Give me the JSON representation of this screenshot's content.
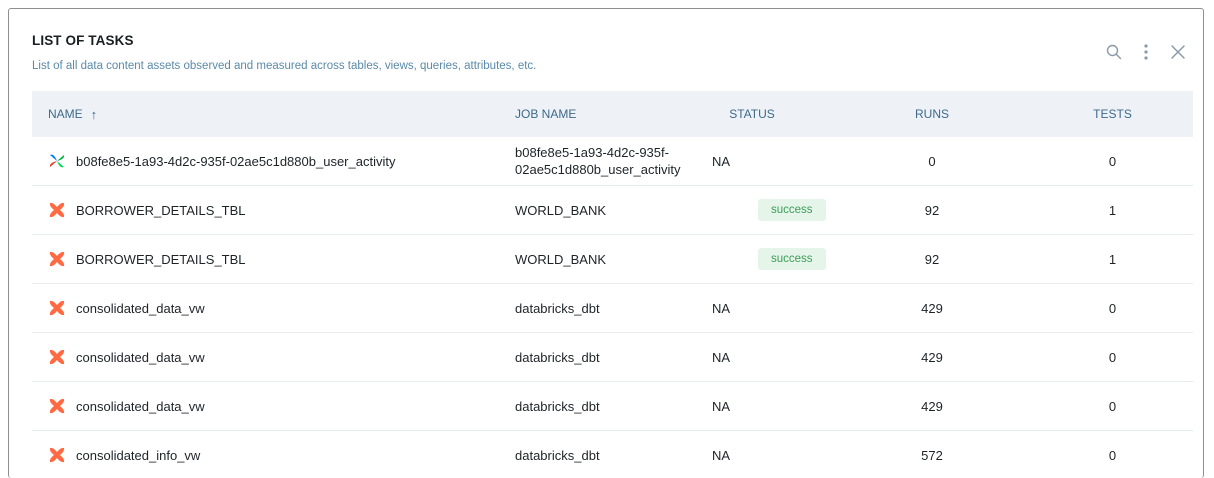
{
  "header": {
    "title": "LIST OF TASKS",
    "subtitle": "List of all data content assets observed and measured across tables, views, queries, attributes, etc."
  },
  "columns": {
    "name": "NAME",
    "sort_glyph": "↑",
    "job": "JOB NAME",
    "status": "STATUS",
    "runs": "RUNS",
    "tests": "TESTS"
  },
  "colors": {
    "accent": "#5a8aa8",
    "success_bg": "#e6f5ea",
    "success_text": "#3a9e57",
    "dbt_orange": "#ff6a43"
  },
  "rows": [
    {
      "icon": "airflow-icon",
      "name": "b08fe8e5-1a93-4d2c-935f-02ae5c1d880b_user_activity",
      "job_line1": "b08fe8e5-1a93-4d2c-935f-",
      "job_line2": "02ae5c1d880b_user_activity",
      "status": "NA",
      "runs": "0",
      "tests": "0"
    },
    {
      "icon": "dbt-icon",
      "name": "BORROWER_DETAILS_TBL",
      "job_line1": "WORLD_BANK",
      "job_line2": "",
      "status": "success",
      "runs": "92",
      "tests": "1"
    },
    {
      "icon": "dbt-icon",
      "name": "BORROWER_DETAILS_TBL",
      "job_line1": "WORLD_BANK",
      "job_line2": "",
      "status": "success",
      "runs": "92",
      "tests": "1"
    },
    {
      "icon": "dbt-icon",
      "name": "consolidated_data_vw",
      "job_line1": "databricks_dbt",
      "job_line2": "",
      "status": "NA",
      "runs": "429",
      "tests": "0"
    },
    {
      "icon": "dbt-icon",
      "name": "consolidated_data_vw",
      "job_line1": "databricks_dbt",
      "job_line2": "",
      "status": "NA",
      "runs": "429",
      "tests": "0"
    },
    {
      "icon": "dbt-icon",
      "name": "consolidated_data_vw",
      "job_line1": "databricks_dbt",
      "job_line2": "",
      "status": "NA",
      "runs": "429",
      "tests": "0"
    },
    {
      "icon": "dbt-icon",
      "name": "consolidated_info_vw",
      "job_line1": "databricks_dbt",
      "job_line2": "",
      "status": "NA",
      "runs": "572",
      "tests": "0"
    }
  ]
}
